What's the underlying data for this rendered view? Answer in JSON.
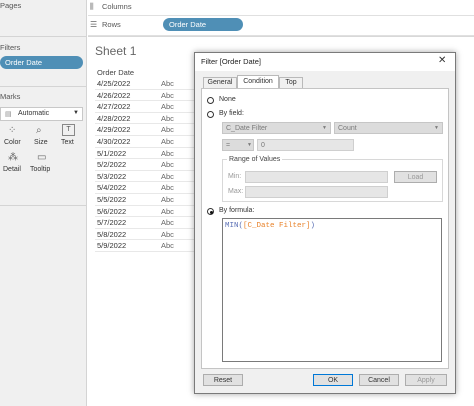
{
  "left_panel": {
    "pages_title": "Pages",
    "filters_title": "Filters",
    "filter_pill": "Order Date",
    "marks_title": "Marks",
    "mark_type": "Automatic",
    "mark_buttons": [
      {
        "label": "Color",
        "icon": "color-icon"
      },
      {
        "label": "Size",
        "icon": "size-icon"
      },
      {
        "label": "Text",
        "icon": "text-icon"
      },
      {
        "label": "Detail",
        "icon": "detail-icon"
      },
      {
        "label": "Tooltip",
        "icon": "tooltip-icon"
      }
    ]
  },
  "shelves": {
    "columns_label": "Columns",
    "rows_label": "Rows",
    "rows_pill": "Order Date"
  },
  "sheet": {
    "title": "Sheet 1",
    "column_header": "Order Date",
    "rows": [
      {
        "date": "4/25/2022",
        "value": "Abc"
      },
      {
        "date": "4/26/2022",
        "value": "Abc"
      },
      {
        "date": "4/27/2022",
        "value": "Abc"
      },
      {
        "date": "4/28/2022",
        "value": "Abc"
      },
      {
        "date": "4/29/2022",
        "value": "Abc"
      },
      {
        "date": "4/30/2022",
        "value": "Abc"
      },
      {
        "date": "5/1/2022",
        "value": "Abc"
      },
      {
        "date": "5/2/2022",
        "value": "Abc"
      },
      {
        "date": "5/3/2022",
        "value": "Abc"
      },
      {
        "date": "5/4/2022",
        "value": "Abc"
      },
      {
        "date": "5/5/2022",
        "value": "Abc"
      },
      {
        "date": "5/6/2022",
        "value": "Abc"
      },
      {
        "date": "5/7/2022",
        "value": "Abc"
      },
      {
        "date": "5/8/2022",
        "value": "Abc"
      },
      {
        "date": "5/9/2022",
        "value": "Abc"
      }
    ]
  },
  "dialog": {
    "title": "Filter [Order Date]",
    "close_glyph": "✕",
    "tabs": [
      "General",
      "Condition",
      "Top"
    ],
    "active_tab": "Condition",
    "option_none": "None",
    "option_by_field": "By field:",
    "field_dropdown": "C_Date Filter",
    "aggregation_dropdown": "Count",
    "operator_dropdown": "=",
    "value_input": "0",
    "range_title": "Range of Values",
    "min_label": "Min:",
    "max_label": "Max:",
    "load_button": "Load",
    "option_by_formula": "By formula:",
    "formula_func": "MIN(",
    "formula_field": "[C_Date Filter]",
    "formula_close": ")",
    "buttons": {
      "reset": "Reset",
      "ok": "OK",
      "cancel": "Cancel",
      "apply": "Apply"
    }
  },
  "colors": {
    "pill": "#4f8fb6",
    "formula_function": "#5a6fb5",
    "formula_field": "#e8822a",
    "ok_border": "#0078d7"
  }
}
